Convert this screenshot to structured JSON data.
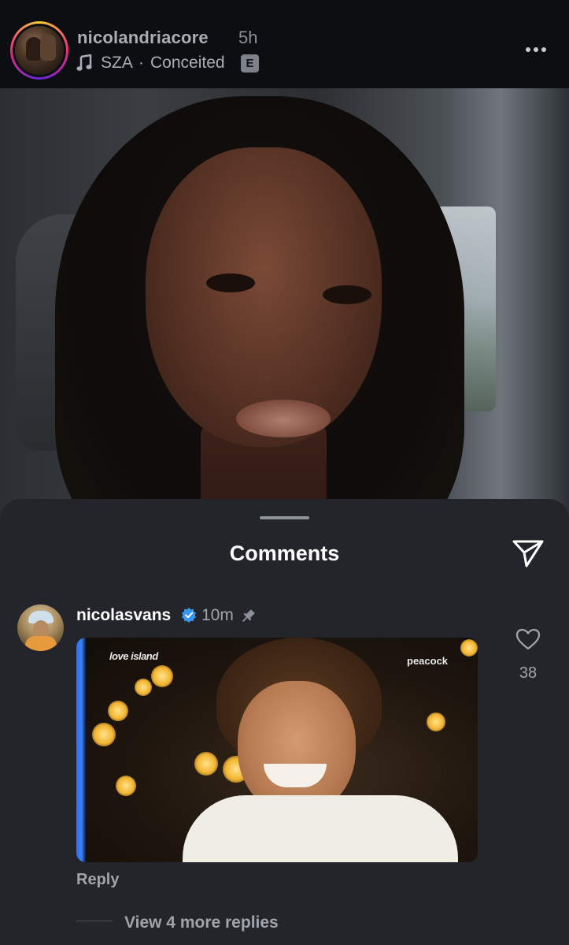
{
  "story": {
    "username": "nicolandriacore",
    "time": "5h",
    "music": {
      "artist": "SZA",
      "separator": "·",
      "song": "Conceited",
      "explicit_badge": "E"
    },
    "icons": {
      "music": "music-note-icon",
      "more": "more-options-icon"
    }
  },
  "comments_sheet": {
    "title": "Comments",
    "share_icon": "send-icon",
    "comment": {
      "username": "nicolasvans",
      "verified_icon": "verified-badge-icon",
      "time": "10m",
      "pin_icon": "pin-icon",
      "gif": {
        "logo_left": "love island",
        "logo_right": "peacock"
      },
      "reply_label": "Reply",
      "like_icon": "heart-icon",
      "like_count": "38"
    },
    "view_replies": "View 4 more replies"
  },
  "colors": {
    "background": "#0b0d10",
    "sheet": "#23252b",
    "verified": "#3897f0",
    "muted_text": "#a0a4ab"
  }
}
